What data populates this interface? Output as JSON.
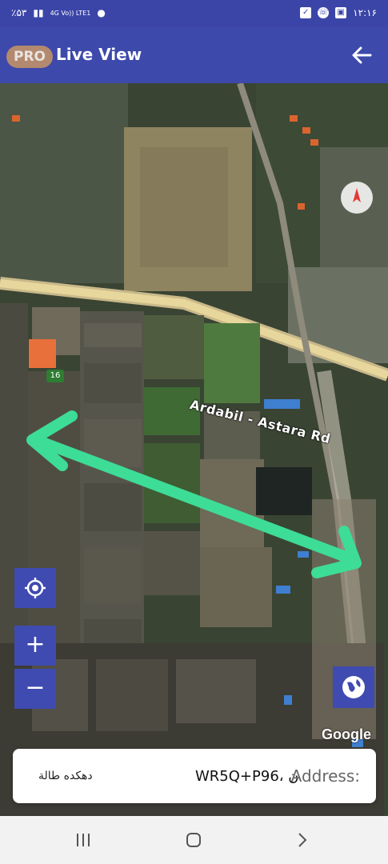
{
  "status_bar": {
    "battery": "٪۵۳",
    "network": "4G Vo)) LTE1",
    "time": "۱۲:۱۶"
  },
  "app_bar": {
    "badge": "PRO",
    "title": "Live View"
  },
  "map": {
    "road_label": "Ardabil - Astara Rd",
    "route_number": "16",
    "attribution": "Google"
  },
  "controls": {
    "zoom_in": "+",
    "zoom_out": "−"
  },
  "address": {
    "label": "Address:",
    "plus_code": "WR5Q+P96، ن",
    "village": "دهکده طالة"
  },
  "colors": {
    "app_bar": "#3d49ab",
    "arrow": "#3ddc97",
    "button": "#3f4bb0"
  }
}
